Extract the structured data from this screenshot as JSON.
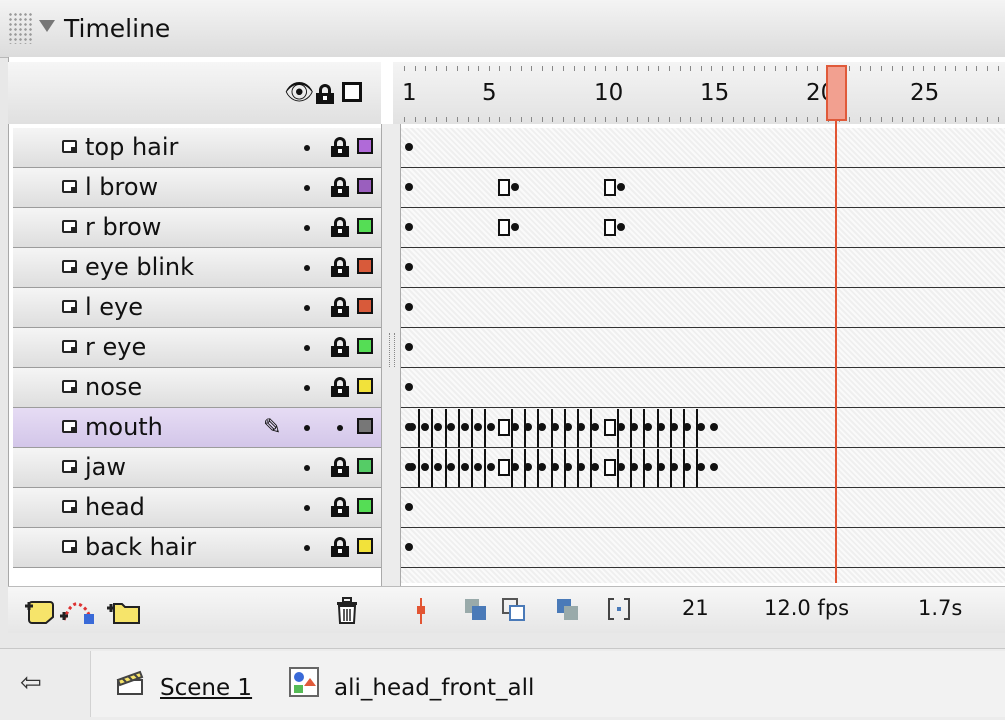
{
  "panel": {
    "title": "Timeline"
  },
  "header_icons": [
    "eye-icon",
    "lock-icon",
    "outline-icon"
  ],
  "ruler": {
    "labels": [
      "1",
      "5",
      "10",
      "15",
      "20",
      "25"
    ],
    "current_frame": 21
  },
  "layers": [
    {
      "name": "top hair",
      "color": "#b06ad8",
      "locked": true
    },
    {
      "name": "l brow",
      "color": "#9a5fbe",
      "locked": true
    },
    {
      "name": "r brow",
      "color": "#55dd55",
      "locked": true
    },
    {
      "name": "eye blink",
      "color": "#d85a3a",
      "locked": true
    },
    {
      "name": "l eye",
      "color": "#d85a3a",
      "locked": true
    },
    {
      "name": "r eye",
      "color": "#55dd55",
      "locked": true
    },
    {
      "name": "nose",
      "color": "#f2e23a",
      "locked": true
    },
    {
      "name": "mouth",
      "color": "#777777",
      "locked": false,
      "selected": true,
      "editing": true
    },
    {
      "name": "jaw",
      "color": "#55cc66",
      "locked": true
    },
    {
      "name": "head",
      "color": "#55dd55",
      "locked": true
    },
    {
      "name": "back hair",
      "color": "#f2e23a",
      "locked": true
    }
  ],
  "bottom_toolbar": {
    "left_icons": [
      "insert-layer-icon",
      "add-motion-guide-icon",
      "insert-layer-folder-icon"
    ],
    "delete_icon": "trash-icon",
    "tools": [
      "center-frame-icon",
      "onion-skin-icon",
      "onion-skin-outlines-icon",
      "edit-multiple-frames-icon",
      "modify-onion-markers-icon"
    ],
    "current_frame": "21",
    "frame_rate": "12.0 fps",
    "elapsed_time": "1.7s"
  },
  "scene_bar": {
    "scene": "Scene 1",
    "symbol": "ali_head_front_all"
  }
}
